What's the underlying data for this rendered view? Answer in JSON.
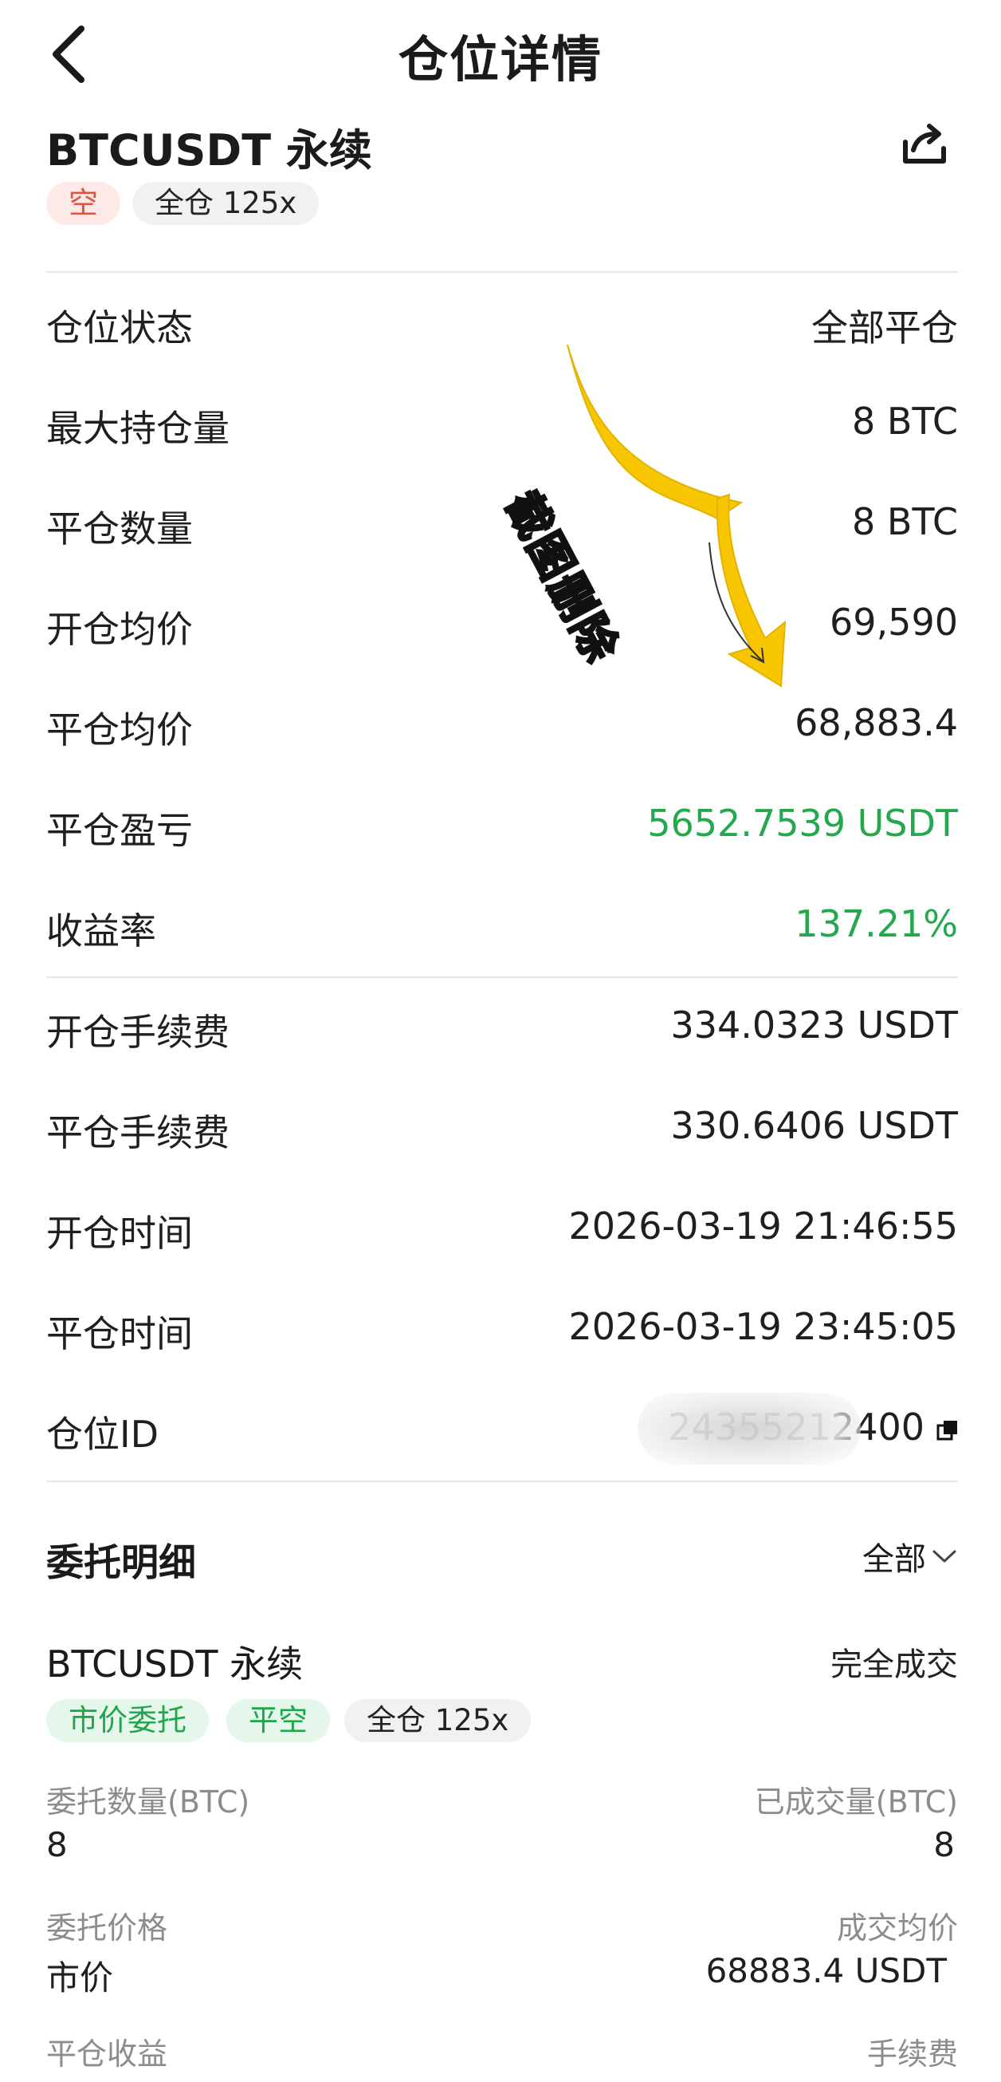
{
  "header": {
    "title": "仓位详情"
  },
  "position": {
    "symbol": "BTCUSDT 永续",
    "side_tag": "空",
    "margin_tag": "全仓 125x"
  },
  "details": [
    {
      "label": "仓位状态",
      "value": "全部平仓",
      "highlight": false
    },
    {
      "label": "最大持仓量",
      "value": "8 BTC",
      "highlight": false
    },
    {
      "label": "平仓数量",
      "value": "8 BTC",
      "highlight": false
    },
    {
      "label": "开仓均价",
      "value": "69,590",
      "highlight": false
    },
    {
      "label": "平仓均价",
      "value": "68,883.4",
      "highlight": false
    },
    {
      "label": "平仓盈亏",
      "value": "5652.7539 USDT",
      "highlight": true
    },
    {
      "label": "收益率",
      "value": "137.21%",
      "highlight": true
    }
  ],
  "fees": [
    {
      "label": "开仓手续费",
      "value": "334.0323 USDT"
    },
    {
      "label": "平仓手续费",
      "value": "330.6406 USDT"
    },
    {
      "label": "开仓时间",
      "value": "2026-03-19 21:46:55"
    },
    {
      "label": "平仓时间",
      "value": "2026-03-19 23:45:05"
    },
    {
      "label": "仓位ID",
      "value": "24355212⁠⁠⁠⁠⁠⁠⁠⁠⁠⁠⁠400"
    }
  ],
  "watermark_text": "截图删除",
  "orders_section": {
    "title": "委托明细",
    "filter_label": "全部"
  },
  "order": {
    "symbol": "BTCUSDT 永续",
    "status": "完全成交",
    "tags": [
      "市价委托",
      "平空",
      "全仓 125x"
    ],
    "qty_label": "委托数量(BTC)",
    "qty_value": "8",
    "filled_label": "已成交量(BTC)",
    "filled_value": "8",
    "price_label": "委托价格",
    "price_value": "市价",
    "avg_label": "成交均价",
    "avg_value": "68883.4 USDT",
    "pnl_label": "平仓收益",
    "fee_label": "手续费"
  },
  "colors": {
    "profit_green": "#24a84d",
    "short_red": "#e0533d",
    "arrow_yellow": "#f7c600"
  },
  "icons": {
    "back": "chevron-left-icon",
    "share": "share-icon",
    "copy": "copy-icon",
    "dropdown": "chevron-down-icon",
    "arrow": "curved-arrow-icon"
  }
}
